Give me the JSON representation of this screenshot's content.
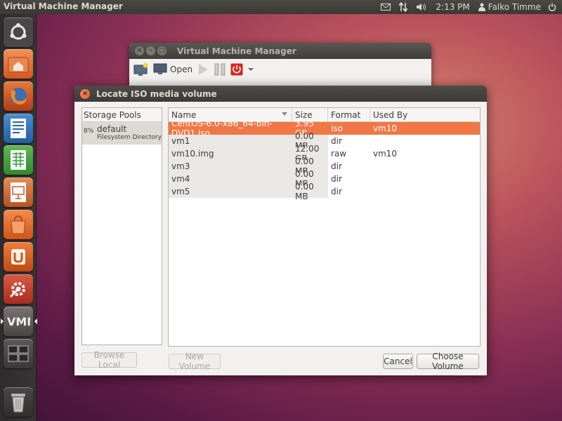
{
  "top_panel": {
    "app_title": "Virtual Machine Manager",
    "clock": "2:13 PM",
    "user": "Falko Timme"
  },
  "launcher": {
    "items": [
      {
        "name": "dash-home",
        "icon": "ubuntu-logo-icon",
        "color": "#4b4748"
      },
      {
        "name": "home-folder",
        "icon": "home-folder-icon",
        "color": "#e0622b"
      },
      {
        "name": "firefox",
        "icon": "firefox-icon",
        "color": "#c2481f"
      },
      {
        "name": "libreoffice-writer",
        "icon": "writer-icon",
        "color": "#2b6aa3"
      },
      {
        "name": "libreoffice-calc",
        "icon": "calc-icon",
        "color": "#3f9a3a"
      },
      {
        "name": "libreoffice-impress",
        "icon": "impress-icon",
        "color": "#c8622e"
      },
      {
        "name": "software-center",
        "icon": "shopping-bag-icon",
        "color": "#e26b2c"
      },
      {
        "name": "ubuntu-one",
        "icon": "ubuntu-one-icon",
        "color": "#d35a1f"
      },
      {
        "name": "system-settings",
        "icon": "settings-icon",
        "color": "#c7432c"
      },
      {
        "name": "virt-manager",
        "icon": "vmm-icon",
        "color": "#5a5454"
      },
      {
        "name": "workspace-switcher",
        "icon": "workspaces-icon",
        "color": "#4c4849"
      },
      {
        "name": "trash",
        "icon": "trash-icon",
        "color": "#3b3738"
      }
    ]
  },
  "back_window": {
    "title": "Virtual Machine Manager",
    "open_label": "Open"
  },
  "dialog": {
    "title": "Locate ISO media volume",
    "pools_header": "Storage Pools",
    "pool": {
      "pct": "8%",
      "name": "default",
      "type": "Filesystem Directory"
    },
    "columns": {
      "name": "Name",
      "size": "Size",
      "format": "Format",
      "used_by": "Used By"
    },
    "volumes": [
      {
        "name": "CentOS-6.0-x86_64-bin-DVD1.iso",
        "size": "3.95 GB",
        "format": "iso",
        "used_by": "vm10"
      },
      {
        "name": "vm1",
        "size": "0.00 MB",
        "format": "dir",
        "used_by": ""
      },
      {
        "name": "vm10.img",
        "size": "12.00 GB",
        "format": "raw",
        "used_by": "vm10"
      },
      {
        "name": "vm3",
        "size": "0.00 MB",
        "format": "dir",
        "used_by": ""
      },
      {
        "name": "vm4",
        "size": "0.00 MB",
        "format": "dir",
        "used_by": ""
      },
      {
        "name": "vm5",
        "size": "0.00 MB",
        "format": "dir",
        "used_by": ""
      }
    ],
    "buttons": {
      "browse_local": "Browse Local",
      "new_volume": "New Volume",
      "cancel": "Cancel",
      "choose_volume": "Choose Volume"
    }
  },
  "colors": {
    "selection": "#f07746",
    "close_button": "#e05f2e"
  }
}
